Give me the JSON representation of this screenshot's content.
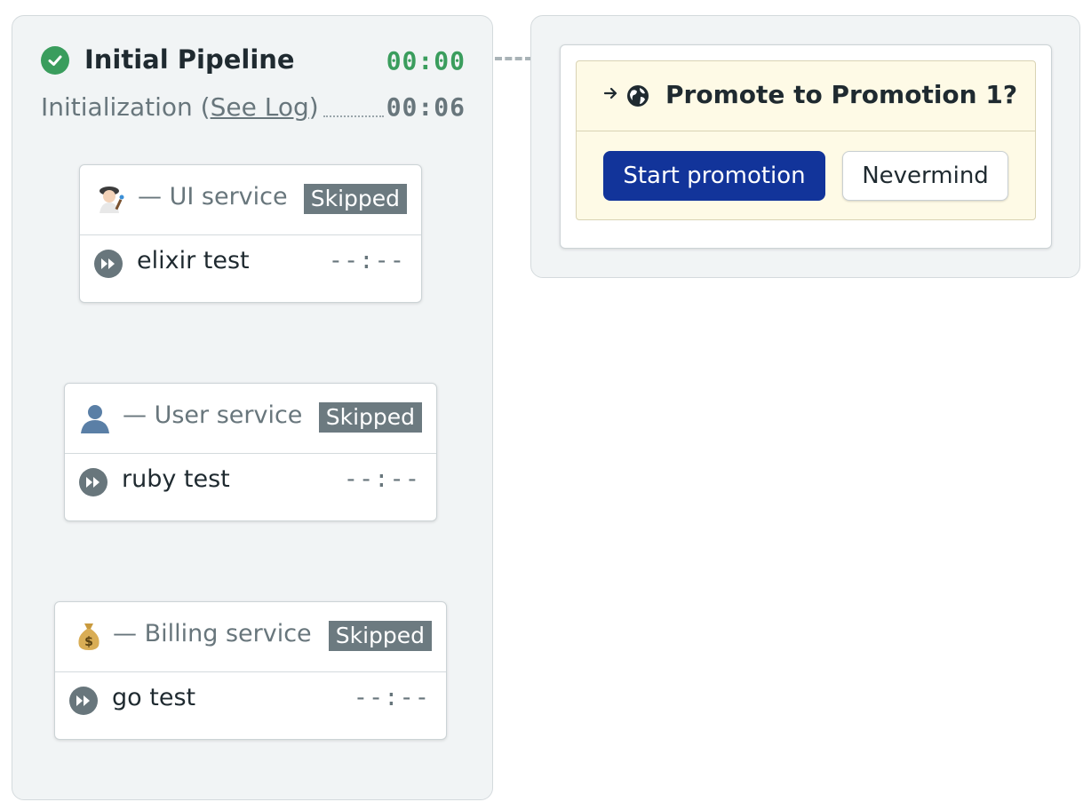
{
  "pipeline": {
    "title": "Initial Pipeline",
    "status_icon": "check-circle-icon",
    "duration": "00:00",
    "init_label": "Initialization (",
    "see_log": "See Log",
    "init_close": ")",
    "init_duration": "00:06"
  },
  "blocks": [
    {
      "name": "— UI service",
      "icon": "artist-emoji-icon",
      "badge": "Skipped",
      "jobs": [
        {
          "name": "elixir test",
          "time": "--:--"
        }
      ]
    },
    {
      "name": "— User service",
      "icon": "user-silhouette-icon",
      "badge": "Skipped",
      "jobs": [
        {
          "name": "ruby test",
          "time": "--:--"
        }
      ]
    },
    {
      "name": "— Billing service",
      "icon": "money-bag-icon",
      "badge": "Skipped",
      "jobs": [
        {
          "name": "go test",
          "time": "--:--"
        }
      ]
    }
  ],
  "promotion": {
    "title": "Promote to Promotion 1?",
    "icons": [
      "arrow-right-icon",
      "globe-icon"
    ],
    "start_label": "Start promotion",
    "cancel_label": "Nevermind"
  },
  "colors": {
    "success": "#3a9d5d",
    "primary": "#12349a",
    "badge": "#6c7a80",
    "promo_bg": "#fefae6"
  }
}
